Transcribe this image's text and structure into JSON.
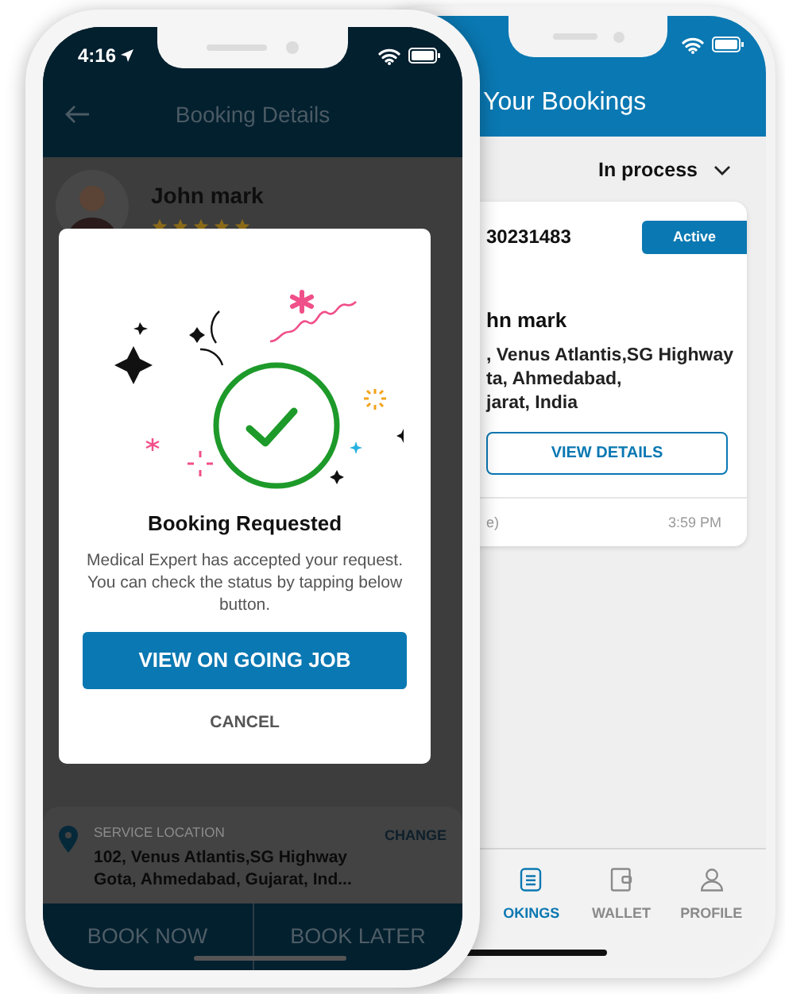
{
  "front_screen": {
    "status_bar": {
      "time": "4:16"
    },
    "header": {
      "title": "Booking Details"
    },
    "profile": {
      "name": "John mark",
      "stars": 5
    },
    "location": {
      "label": "SERVICE LOCATION",
      "address_lines": [
        "102, Venus Atlantis,SG Highway",
        "Gota, Ahmedabad, Gujarat, Ind..."
      ],
      "action": "CHANGE"
    },
    "actions": [
      "BOOK NOW",
      "BOOK LATER"
    ]
  },
  "dialog": {
    "title": "Booking Requested",
    "message": "Medical Expert has accepted your request. You can check the status by tapping below button.",
    "primary_button": "VIEW ON GOING JOB",
    "secondary_button": "CANCEL"
  },
  "back_screen": {
    "header": {
      "title": "Your Bookings"
    },
    "filter": {
      "value": "In process"
    },
    "booking": {
      "number": "30231483",
      "status": "Active",
      "name": "hn mark",
      "address_lines": [
        ", Venus Atlantis,SG Highway",
        "ta, Ahmedabad,",
        "jarat, India"
      ],
      "button": "VIEW DETAILS",
      "footer_note": "e)",
      "time": "3:59 PM"
    },
    "nav": [
      {
        "label": "OKINGS",
        "kind": "bookings",
        "selected": true
      },
      {
        "label": "WALLET",
        "kind": "wallet",
        "selected": false
      },
      {
        "label": "PROFILE",
        "kind": "profile",
        "selected": false
      }
    ]
  }
}
